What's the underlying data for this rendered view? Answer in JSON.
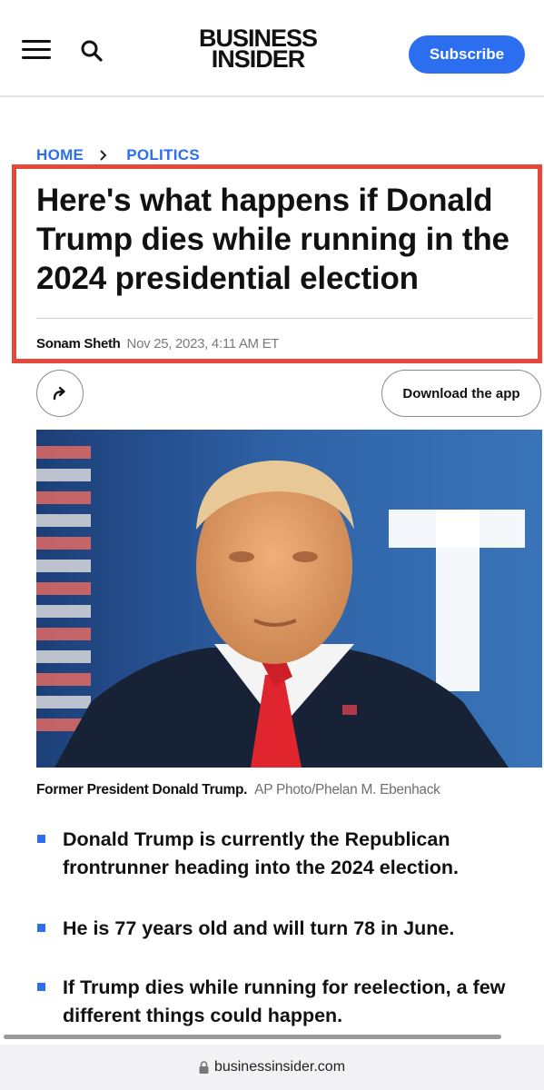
{
  "header": {
    "logo_line1": "BUSINESS",
    "logo_line2": "INSIDER",
    "subscribe_label": "Subscribe",
    "accent_color": "#2b6ff0"
  },
  "breadcrumb": {
    "home": "HOME",
    "section": "POLITICS"
  },
  "article": {
    "headline": "Here's what happens if Donald Trump dies while running in the 2024 presidential election",
    "author": "Sonam Sheth",
    "date": "Nov 25, 2023, 4:11 AM ET",
    "download_label": "Download the app",
    "caption": "Former President Donald Trump.",
    "credit": "AP Photo/Phelan M. Ebenhack",
    "bullets": [
      "Donald Trump is currently the Republican frontrunner heading into the 2024 election.",
      "He is 77 years old and will turn 78 in June.",
      "If Trump dies while running for reelection, a few different things could happen."
    ]
  },
  "browser": {
    "url": "businessinsider.com"
  },
  "icons": {
    "menu": "menu-icon",
    "search": "search-icon",
    "share": "share-icon",
    "lock": "lock-icon"
  },
  "highlight_color": "#e5473a"
}
